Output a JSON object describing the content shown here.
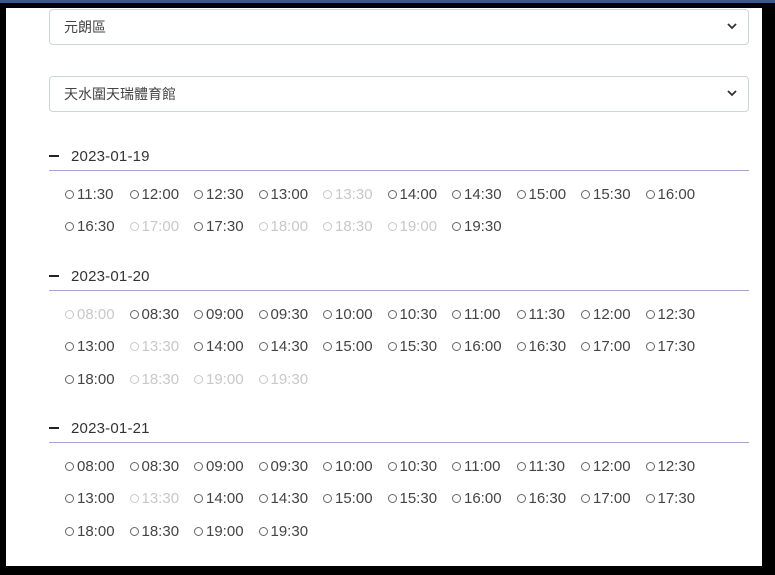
{
  "district_select": {
    "value": "元朗區"
  },
  "venue_select": {
    "value": "天水圍天瑞體育館"
  },
  "sections": [
    {
      "date": "2023-01-19",
      "slots": [
        {
          "time": "11:30",
          "available": true
        },
        {
          "time": "12:00",
          "available": true
        },
        {
          "time": "12:30",
          "available": true
        },
        {
          "time": "13:00",
          "available": true
        },
        {
          "time": "13:30",
          "available": false
        },
        {
          "time": "14:00",
          "available": true
        },
        {
          "time": "14:30",
          "available": true
        },
        {
          "time": "15:00",
          "available": true
        },
        {
          "time": "15:30",
          "available": true
        },
        {
          "time": "16:00",
          "available": true
        },
        {
          "time": "16:30",
          "available": true
        },
        {
          "time": "17:00",
          "available": false
        },
        {
          "time": "17:30",
          "available": true
        },
        {
          "time": "18:00",
          "available": false
        },
        {
          "time": "18:30",
          "available": false
        },
        {
          "time": "19:00",
          "available": false
        },
        {
          "time": "19:30",
          "available": true
        }
      ]
    },
    {
      "date": "2023-01-20",
      "slots": [
        {
          "time": "08:00",
          "available": false
        },
        {
          "time": "08:30",
          "available": true
        },
        {
          "time": "09:00",
          "available": true
        },
        {
          "time": "09:30",
          "available": true
        },
        {
          "time": "10:00",
          "available": true
        },
        {
          "time": "10:30",
          "available": true
        },
        {
          "time": "11:00",
          "available": true
        },
        {
          "time": "11:30",
          "available": true
        },
        {
          "time": "12:00",
          "available": true
        },
        {
          "time": "12:30",
          "available": true
        },
        {
          "time": "13:00",
          "available": true
        },
        {
          "time": "13:30",
          "available": false
        },
        {
          "time": "14:00",
          "available": true
        },
        {
          "time": "14:30",
          "available": true
        },
        {
          "time": "15:00",
          "available": true
        },
        {
          "time": "15:30",
          "available": true
        },
        {
          "time": "16:00",
          "available": true
        },
        {
          "time": "16:30",
          "available": true
        },
        {
          "time": "17:00",
          "available": true
        },
        {
          "time": "17:30",
          "available": true
        },
        {
          "time": "18:00",
          "available": true
        },
        {
          "time": "18:30",
          "available": false
        },
        {
          "time": "19:00",
          "available": false
        },
        {
          "time": "19:30",
          "available": false
        }
      ]
    },
    {
      "date": "2023-01-21",
      "slots": [
        {
          "time": "08:00",
          "available": true
        },
        {
          "time": "08:30",
          "available": true
        },
        {
          "time": "09:00",
          "available": true
        },
        {
          "time": "09:30",
          "available": true
        },
        {
          "time": "10:00",
          "available": true
        },
        {
          "time": "10:30",
          "available": true
        },
        {
          "time": "11:00",
          "available": true
        },
        {
          "time": "11:30",
          "available": true
        },
        {
          "time": "12:00",
          "available": true
        },
        {
          "time": "12:30",
          "available": true
        },
        {
          "time": "13:00",
          "available": true
        },
        {
          "time": "13:30",
          "available": false
        },
        {
          "time": "14:00",
          "available": true
        },
        {
          "time": "14:30",
          "available": true
        },
        {
          "time": "15:00",
          "available": true
        },
        {
          "time": "15:30",
          "available": true
        },
        {
          "time": "16:00",
          "available": true
        },
        {
          "time": "16:30",
          "available": true
        },
        {
          "time": "17:00",
          "available": true
        },
        {
          "time": "17:30",
          "available": true
        },
        {
          "time": "18:00",
          "available": true
        },
        {
          "time": "18:30",
          "available": true
        },
        {
          "time": "19:00",
          "available": true
        },
        {
          "time": "19:30",
          "available": true
        }
      ]
    }
  ]
}
